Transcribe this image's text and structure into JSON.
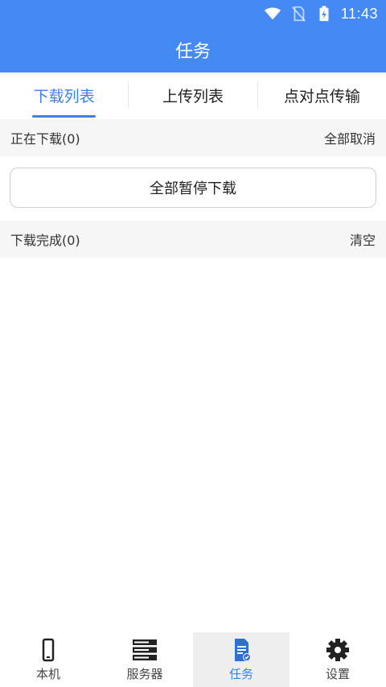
{
  "status_bar": {
    "time": "11:43",
    "icons": [
      "wifi-icon",
      "no-sim-icon",
      "battery-charging-icon"
    ]
  },
  "app_bar": {
    "title": "任务"
  },
  "tabs": [
    {
      "label": "下载列表",
      "active": true
    },
    {
      "label": "上传列表",
      "active": false
    },
    {
      "label": "点对点传输",
      "active": false
    }
  ],
  "downloading": {
    "title": "正在下载(0)",
    "action": "全部取消",
    "pause_all_label": "全部暂停下载"
  },
  "completed": {
    "title": "下载完成(0)",
    "action": "清空"
  },
  "bottom_nav": [
    {
      "label": "本机",
      "icon": "phone-icon",
      "active": false
    },
    {
      "label": "服务器",
      "icon": "server-icon",
      "active": false
    },
    {
      "label": "任务",
      "icon": "task-document-icon",
      "active": true
    },
    {
      "label": "设置",
      "icon": "gear-icon",
      "active": false
    }
  ],
  "colors": {
    "primary": "#4589f5",
    "accent": "#3b82e8",
    "section_bg": "#f6f6f6"
  }
}
